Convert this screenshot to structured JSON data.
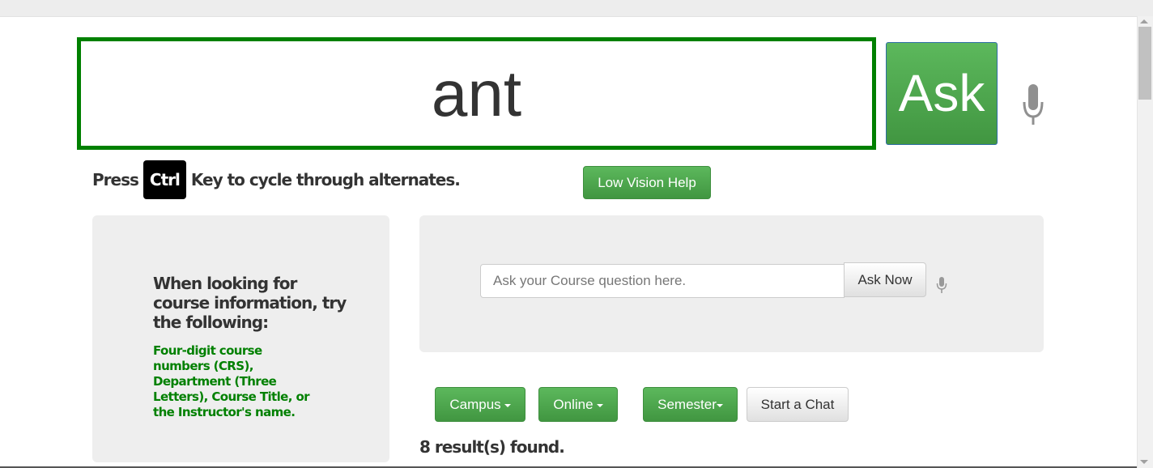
{
  "main_query": {
    "value": "ant",
    "ask_label": "Ask",
    "mic_icon": "microphone-icon"
  },
  "hint": {
    "before": "Press",
    "key": "Ctrl",
    "after": "Key to cycle through alternates."
  },
  "low_vision_label": "Low Vision Help",
  "left_panel": {
    "title": "When looking for course information, try the following:",
    "text": "Four-digit course numbers (CRS), Department (Three Letters), Course Title, or the Instructor's name."
  },
  "course_search": {
    "placeholder": "Ask your Course question here.",
    "button_label": "Ask Now",
    "mic_icon": "microphone-icon"
  },
  "filters": {
    "campus": "Campus",
    "online": "Online",
    "semester": "Semester",
    "chat": "Start a Chat"
  },
  "results_text": "8 result(s) found.",
  "colors": {
    "accent_green": "#5cb85c",
    "border_green": "#008000",
    "panel_bg": "#eeeeee"
  }
}
